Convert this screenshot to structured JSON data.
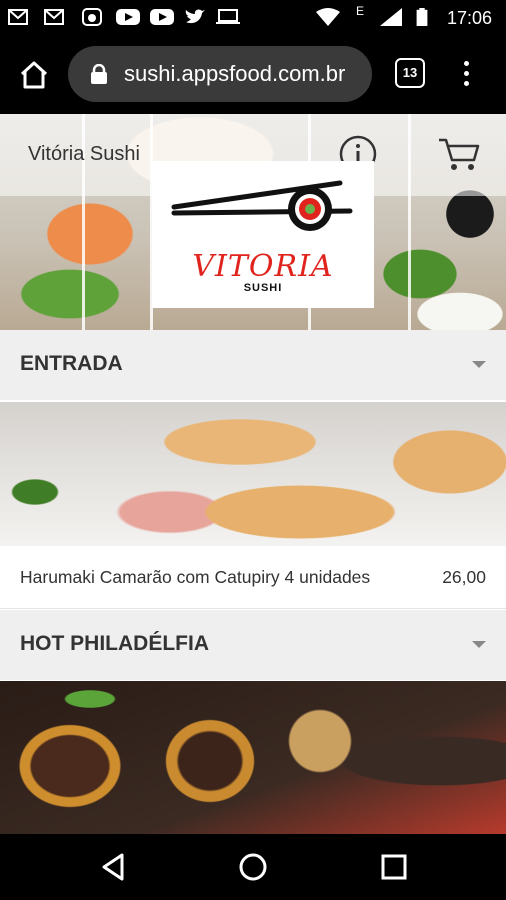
{
  "status_bar": {
    "time": "17:06",
    "notification_icons": [
      "gmail-icon",
      "gmail-icon",
      "photo-icon",
      "youtube-icon",
      "youtube-icon",
      "twitter-icon",
      "laptop-icon"
    ],
    "network_type": "E"
  },
  "browser": {
    "url": "sushi.appsfood.com.br",
    "tab_count": "13"
  },
  "header": {
    "store_name": "Vitória Sushi",
    "logo_text": "VITORIA",
    "logo_subtext": "SUSHI"
  },
  "categories": [
    {
      "title": "ENTRADA",
      "items": [
        {
          "name": "Harumaki Camarão com Catupiry 4 unidades",
          "price": "26,00"
        }
      ]
    },
    {
      "title": "HOT PHILADÉLFIA",
      "items": []
    }
  ],
  "colors": {
    "brand_red": "#e0241d",
    "category_bg": "#efefef",
    "text": "#333333"
  }
}
